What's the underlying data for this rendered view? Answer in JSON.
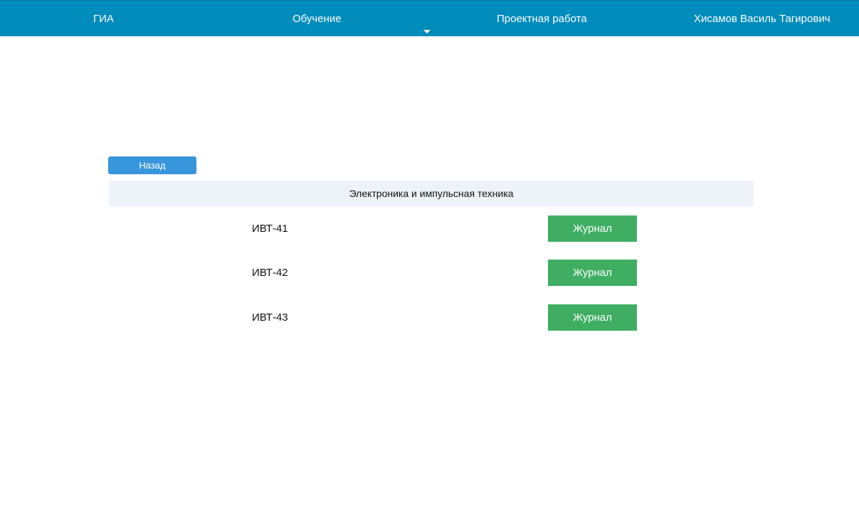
{
  "nav": {
    "gia": "ГИА",
    "learning": "Обучение",
    "project": "Проектная работа",
    "user": "Хисамов Василь Тагирович"
  },
  "icons": {
    "learning_dropdown": "caret-down-icon"
  },
  "colors": {
    "topbar": "#018cbc",
    "back_button": "#3796dc",
    "journal_button": "#3fae63",
    "subject_header_bg": "#edf3f9"
  },
  "back_label": "Назад",
  "subject": "Электроника и импульсная техника",
  "groups": [
    {
      "name": "ИВТ-41",
      "button": "Журнал"
    },
    {
      "name": "ИВТ-42",
      "button": "Журнал"
    },
    {
      "name": "ИВТ-43",
      "button": "Журнал"
    }
  ]
}
